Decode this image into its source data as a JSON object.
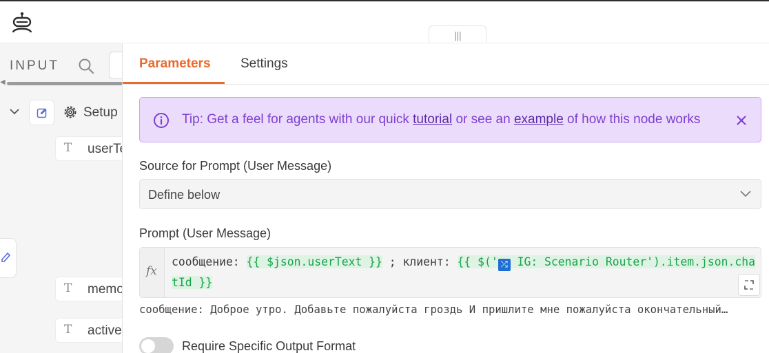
{
  "left_panel": {
    "title": "INPUT",
    "tree": {
      "node_label": "Setup",
      "fields": [
        {
          "type_icon": "T",
          "label": "userText"
        },
        {
          "type_icon": "T",
          "label": "memoryKey"
        },
        {
          "type_icon": "T",
          "label": "activeScenario"
        }
      ]
    }
  },
  "tabs": [
    {
      "label": "Parameters",
      "active": true
    },
    {
      "label": "Settings",
      "active": false
    }
  ],
  "tip": {
    "prefix": "Tip: Get a feel for agents with our quick ",
    "link1": "tutorial",
    "middle": " or see an ",
    "link2": "example",
    "suffix": " of how this node works"
  },
  "source": {
    "label": "Source for Prompt (User Message)",
    "value": "Define below"
  },
  "prompt": {
    "label": "Prompt (User Message)",
    "fx": "fx",
    "part1": "сообщение: ",
    "expr1": "{{ $json.userText }}",
    "part2": " ; клиент: ",
    "expr2_start": "{{ $('",
    "emoji": "⤮",
    "expr2_end": " IG: Scenario Router').item.json.chatId }}",
    "preview": "сообщение: Доброе утро. Добавьте пожалуйста гроздь И пришлите мне пожалуйста окончательный…"
  },
  "options": {
    "require_format_label": "Require Specific Output Format",
    "require_format_enabled": false
  },
  "colors": {
    "accent": "#ea6a2d",
    "tip_bg": "#ecdcfb",
    "tip_text": "#7c3fd1",
    "expression": "#1aa34a"
  }
}
